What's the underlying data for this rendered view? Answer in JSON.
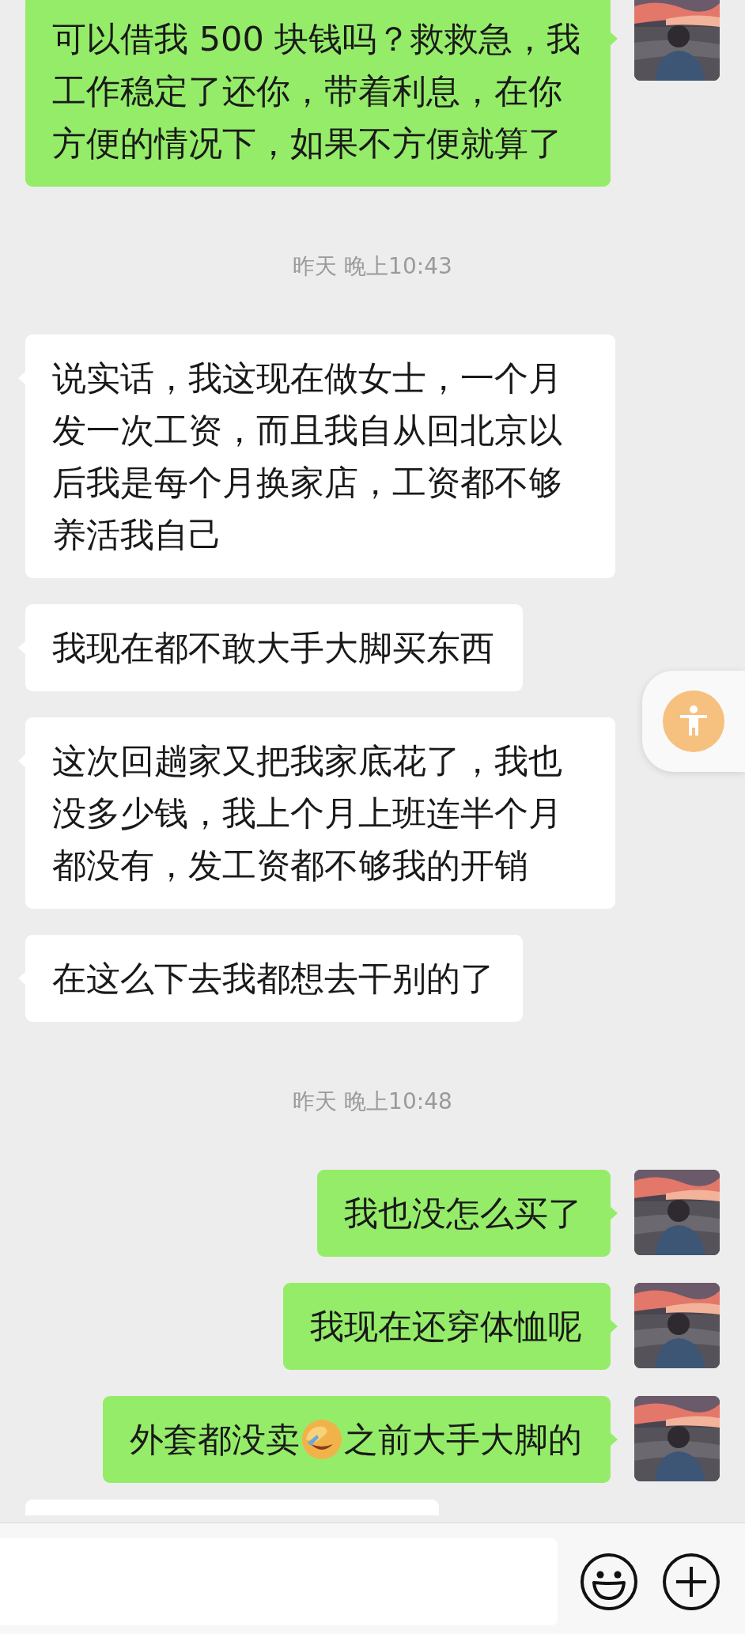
{
  "messages": [
    {
      "kind": "message",
      "outgoing": true,
      "text": "可以借我 500 块钱吗？救救急，我工作稳定了还你，带着利息，在你方便的情况下，如果不方便就算了"
    },
    {
      "kind": "time",
      "text": "昨天 晚上10:43"
    },
    {
      "kind": "message",
      "outgoing": false,
      "text": "说实话，我这现在做女士，一个月发一次工资，而且我自从回北京以后我是每个月换家店，工资都不够养活我自己"
    },
    {
      "kind": "message",
      "outgoing": false,
      "text": "我现在都不敢大手大脚买东西"
    },
    {
      "kind": "message",
      "outgoing": false,
      "text": "这次回趟家又把我家底花了，我也没多少钱，我上个月上班连半个月都没有，发工资都不够我的开销"
    },
    {
      "kind": "message",
      "outgoing": false,
      "text": "在这么下去我都想去干别的了"
    },
    {
      "kind": "time",
      "text": "昨天 晚上10:48"
    },
    {
      "kind": "message",
      "outgoing": true,
      "text": "我也没怎么买了"
    },
    {
      "kind": "message",
      "outgoing": true,
      "text": "我现在还穿体恤呢"
    },
    {
      "kind": "message",
      "outgoing": true,
      "segments": [
        {
          "kind": "text",
          "text": "外套都没卖"
        },
        {
          "kind": "emoji"
        },
        {
          "kind": "text",
          "text": "之前大手大脚的"
        }
      ]
    },
    {
      "kind": "partial"
    }
  ]
}
